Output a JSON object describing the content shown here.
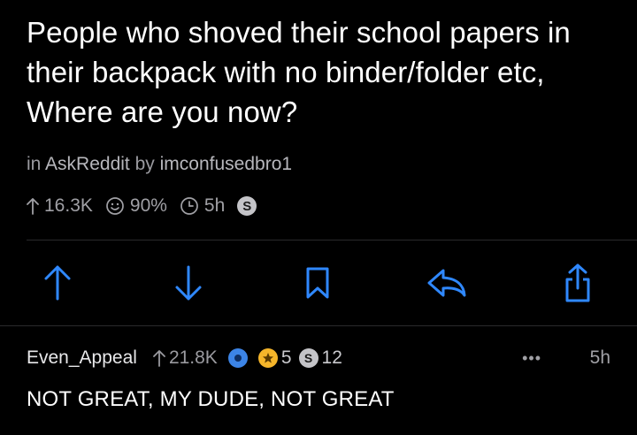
{
  "post": {
    "title": "People who shoved their school papers in their backpack with no binder/folder etc, Where are you now?",
    "in_label": "in",
    "subreddit": "AskReddit",
    "by_label": "by",
    "author": "imconfusedbro1",
    "score": "16.3K",
    "upvote_ratio": "90%",
    "age": "5h",
    "silver_award": "S"
  },
  "actions": [
    "upvote-icon",
    "downvote-icon",
    "bookmark-icon",
    "reply-icon",
    "share-icon"
  ],
  "comment": {
    "author": "Even_Appeal",
    "score": "21.8K",
    "gold_count": "5",
    "silver_count": "12",
    "silver_award": "S",
    "more": "•••",
    "age": "5h",
    "body": "NOT GREAT, MY DUDE, NOT GREAT"
  },
  "colors": {
    "background": "#000000",
    "accent": "#2f88ff",
    "muted_text": "#9a9a9f",
    "gold": "#f5b52a",
    "silver": "#c4c4c8",
    "platinum": "#3c84e6"
  }
}
